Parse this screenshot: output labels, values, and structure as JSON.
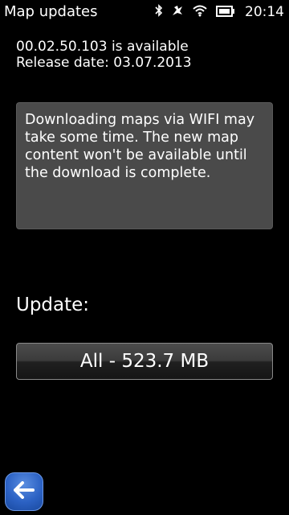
{
  "status_bar": {
    "title": "Map updates",
    "time": "20:14",
    "icons": [
      "bluetooth-icon",
      "signal-icon",
      "wifi-icon",
      "battery-icon"
    ]
  },
  "info": {
    "version_text": "00.02.50.103 is available",
    "release_text": "Release date: 03.07.2013"
  },
  "note": {
    "text": "Downloading maps via WIFI may take some time. The new map content won't be available until the download is complete."
  },
  "update": {
    "label": "Update:",
    "button_label": "All - 523.7 MB"
  },
  "navigation": {
    "back_icon": "back-arrow-icon"
  },
  "colors": {
    "background": "#000000",
    "note_box": "#4a4a4a",
    "back_button": "#2c62c4"
  }
}
